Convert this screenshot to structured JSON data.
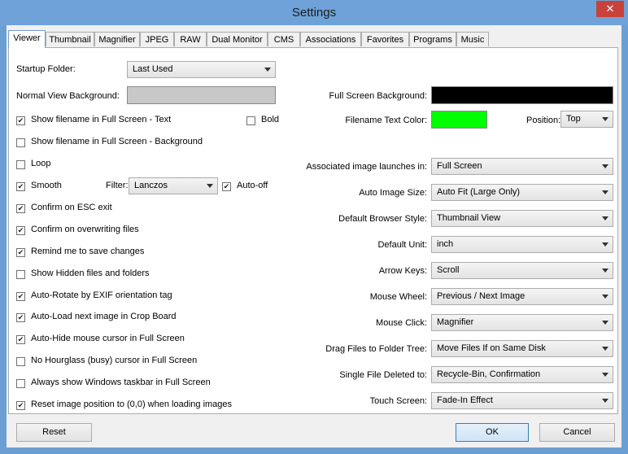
{
  "window": {
    "title": "Settings",
    "close_glyph": "✕"
  },
  "tabs": [
    {
      "label": "Viewer",
      "active": true
    },
    {
      "label": "Thumbnail"
    },
    {
      "label": "Magnifier"
    },
    {
      "label": "JPEG"
    },
    {
      "label": "RAW"
    },
    {
      "label": "Dual Monitor"
    },
    {
      "label": "CMS"
    },
    {
      "label": "Associations"
    },
    {
      "label": "Favorites"
    },
    {
      "label": "Programs"
    },
    {
      "label": "Music"
    }
  ],
  "left": {
    "startup_folder": {
      "label": "Startup Folder:",
      "value": "Last Used"
    },
    "normal_bg": {
      "label": "Normal View Background:",
      "color": "#c8c8c8"
    },
    "checks": [
      {
        "label": "Show filename in Full Screen - Text",
        "checked": true
      },
      {
        "label": "Show filename in Full Screen - Background",
        "checked": false
      },
      {
        "label": "Loop",
        "checked": false
      },
      {
        "label": "Smooth",
        "checked": true
      },
      {
        "label": "Confirm on ESC exit",
        "checked": true
      },
      {
        "label": "Confirm on overwriting files",
        "checked": true
      },
      {
        "label": "Remind me to save changes",
        "checked": true
      },
      {
        "label": "Show Hidden files and folders",
        "checked": false
      },
      {
        "label": "Auto-Rotate by EXIF orientation tag",
        "checked": true
      },
      {
        "label": "Auto-Load next image in Crop Board",
        "checked": true
      },
      {
        "label": "Auto-Hide mouse cursor in Full Screen",
        "checked": true
      },
      {
        "label": "No Hourglass (busy) cursor in Full Screen",
        "checked": false
      },
      {
        "label": "Always show Windows taskbar in Full Screen",
        "checked": false
      },
      {
        "label": "Reset image position to (0,0) when loading images",
        "checked": true
      }
    ],
    "bold": {
      "label": "Bold",
      "checked": false
    },
    "filter": {
      "label": "Filter:",
      "value": "Lanczos"
    },
    "auto_off": {
      "label": "Auto-off",
      "checked": true
    }
  },
  "right": {
    "full_screen_bg": {
      "label": "Full Screen Background:",
      "color": "#000000"
    },
    "filename_text_color": {
      "label": "Filename Text Color:",
      "color": "#00ff00"
    },
    "position": {
      "label": "Position:",
      "value": "Top"
    },
    "rows": [
      {
        "label": "Associated image launches in:",
        "value": "Full Screen"
      },
      {
        "label": "Auto Image Size:",
        "value": "Auto Fit (Large Only)"
      },
      {
        "label": "Default Browser Style:",
        "value": "Thumbnail View"
      },
      {
        "label": "Default Unit:",
        "value": "inch"
      },
      {
        "label": "Arrow Keys:",
        "value": "Scroll"
      },
      {
        "label": "Mouse Wheel:",
        "value": "Previous / Next Image"
      },
      {
        "label": "Mouse Click:",
        "value": "Magnifier"
      },
      {
        "label": "Drag Files to Folder Tree:",
        "value": "Move Files If on Same Disk"
      },
      {
        "label": "Single File Deleted to:",
        "value": "Recycle-Bin, Confirmation"
      },
      {
        "label": "Touch Screen:",
        "value": "Fade-In Effect"
      }
    ]
  },
  "footer": {
    "reset": "Reset",
    "ok": "OK",
    "cancel": "Cancel"
  }
}
